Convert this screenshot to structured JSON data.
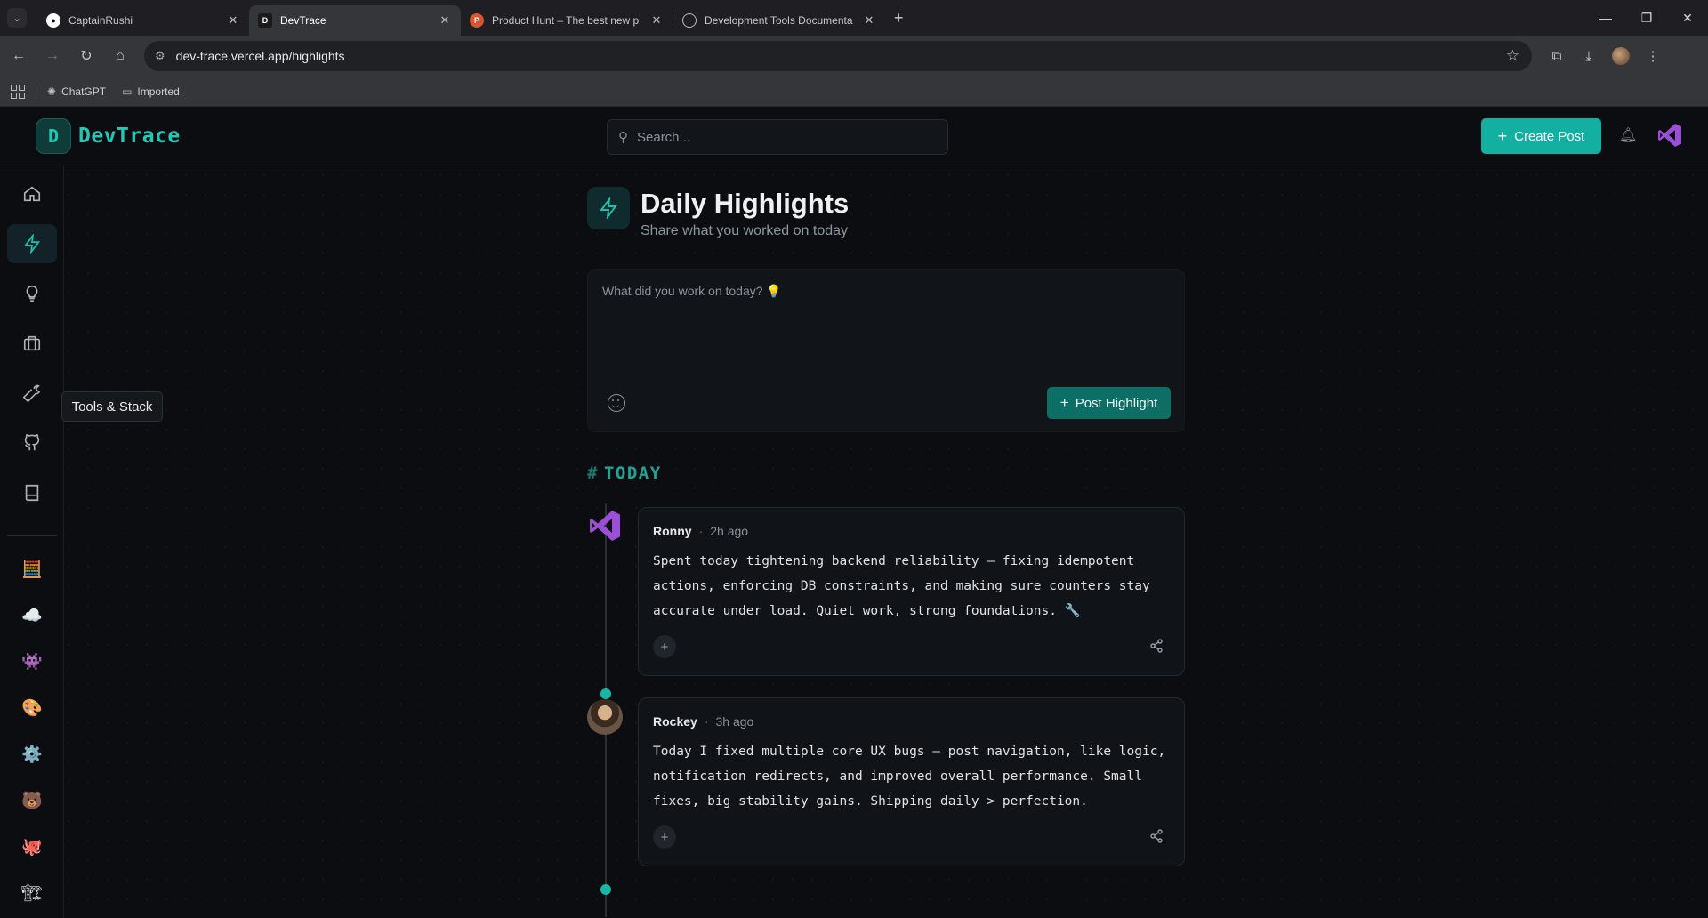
{
  "browser": {
    "tabs": [
      {
        "title": "CaptainRushi",
        "favicon": "github-icon",
        "active": false
      },
      {
        "title": "DevTrace",
        "favicon": "devtrace-icon",
        "active": true
      },
      {
        "title": "Product Hunt – The best new p",
        "favicon": "product-hunt-icon",
        "active": false
      },
      {
        "title": "Development Tools Documenta",
        "favicon": "globe-icon",
        "active": false
      }
    ],
    "url": "dev-trace.vercel.app/highlights",
    "bookmarks": [
      {
        "label": "ChatGPT",
        "icon": "openai-icon"
      },
      {
        "label": "Imported",
        "icon": "folder-icon"
      }
    ]
  },
  "header": {
    "logo_text": "DevTrace",
    "search_placeholder": "Search...",
    "create_label": "Create Post"
  },
  "sidebar": {
    "tooltip": "Tools & Stack",
    "items": [
      "home-icon",
      "zap-icon",
      "lightbulb-icon",
      "briefcase-icon",
      "wrench-icon",
      "github-icon",
      "book-icon"
    ],
    "emoji_items": [
      "🧮",
      "☁️",
      "👾",
      "🎨",
      "⚙️",
      "🐻",
      "🐙",
      "🏗"
    ]
  },
  "page": {
    "title": "Daily Highlights",
    "subtitle": "Share what you worked on today",
    "composer_placeholder": "What did you work on today? 💡",
    "post_button": "Post Highlight",
    "section_hash": "#",
    "section_label": "TODAY"
  },
  "posts": [
    {
      "author": "Ronny",
      "time": "2h ago",
      "body": "Spent today tightening backend reliability — fixing idempotent actions, enforcing DB constraints, and making sure counters stay accurate under load. Quiet work, strong foundations. 🔧",
      "react": "+"
    },
    {
      "author": "Rockey",
      "time": "3h ago",
      "body": "Today I fixed multiple core UX bugs — post navigation, like logic, notification redirects, and improved overall performance. Small fixes, big stability gains. Shipping daily > perfection.",
      "react": "+"
    }
  ],
  "colors": {
    "accent": "#13b0a2",
    "accent_dark": "#0d6e66",
    "background": "#0b0d10"
  }
}
